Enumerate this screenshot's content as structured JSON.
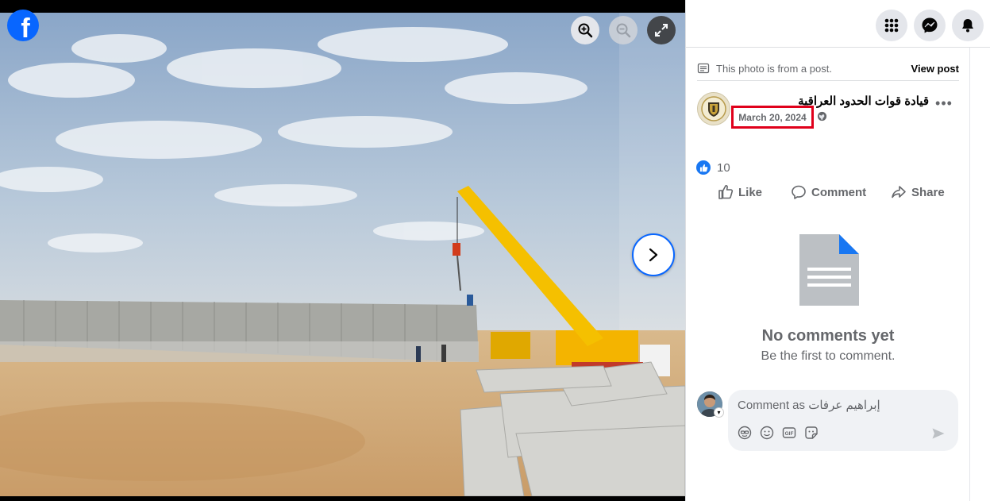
{
  "viewer": {
    "brand_icon": "facebook-logo",
    "controls": [
      "zoom-in-icon",
      "zoom-out-icon",
      "expand-icon"
    ],
    "next_icon": "chevron-right-icon"
  },
  "header": {
    "icons": [
      "menu-grid-icon",
      "messenger-icon",
      "notifications-bell-icon"
    ]
  },
  "post_note": {
    "text": "This photo is from a post.",
    "view_post": "View post"
  },
  "post": {
    "author": "قيادة قوات الحدود العراقية",
    "date": "March 20, 2024",
    "audience_icon": "globe-icon",
    "more": "•••",
    "reaction_count": "10"
  },
  "actions": {
    "like": "Like",
    "comment": "Comment",
    "share": "Share"
  },
  "comments": {
    "empty_title": "No comments yet",
    "empty_subtitle": "Be the first to comment.",
    "input_placeholder": "Comment as إبراهيم عرفات",
    "tools": [
      "avatar-sticker-icon",
      "emoji-icon",
      "gif-icon",
      "sticker-icon"
    ],
    "send_icon": "send-icon"
  },
  "colors": {
    "accent": "#0866ff",
    "highlight_box": "#e0001b"
  }
}
